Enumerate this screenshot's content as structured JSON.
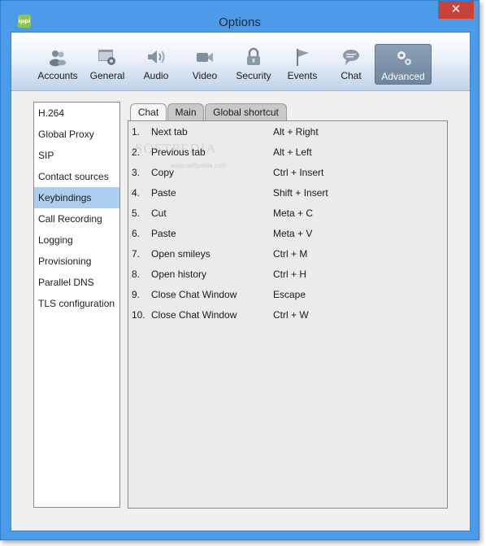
{
  "window": {
    "app_logo": "ippi",
    "title": "Options",
    "close_glyph": "✕"
  },
  "toolbar": {
    "items": [
      {
        "label": "Accounts",
        "icon": "accounts-icon"
      },
      {
        "label": "General",
        "icon": "general-icon"
      },
      {
        "label": "Audio",
        "icon": "audio-icon"
      },
      {
        "label": "Video",
        "icon": "video-icon"
      },
      {
        "label": "Security",
        "icon": "security-icon"
      },
      {
        "label": "Events",
        "icon": "events-icon"
      },
      {
        "label": "Chat",
        "icon": "chat-icon"
      },
      {
        "label": "Advanced",
        "icon": "advanced-icon",
        "active": true
      }
    ]
  },
  "sidebar": {
    "items": [
      {
        "label": "H.264"
      },
      {
        "label": "Global Proxy"
      },
      {
        "label": "SIP"
      },
      {
        "label": "Contact sources"
      },
      {
        "label": "Keybindings",
        "selected": true
      },
      {
        "label": "Call Recording"
      },
      {
        "label": "Logging"
      },
      {
        "label": "Provisioning"
      },
      {
        "label": "Parallel DNS"
      },
      {
        "label": "TLS configuration"
      }
    ]
  },
  "tabs": [
    {
      "label": "Chat",
      "active": true
    },
    {
      "label": "Main"
    },
    {
      "label": "Global shortcut"
    }
  ],
  "keybindings": [
    {
      "num": "1.",
      "action": "Next tab",
      "shortcut": "Alt + Right"
    },
    {
      "num": "2.",
      "action": "Previous tab",
      "shortcut": "Alt + Left"
    },
    {
      "num": "3.",
      "action": "Copy",
      "shortcut": "Ctrl + Insert"
    },
    {
      "num": "4.",
      "action": "Paste",
      "shortcut": "Shift + Insert"
    },
    {
      "num": "5.",
      "action": "Cut",
      "shortcut": "Meta + C"
    },
    {
      "num": "6.",
      "action": "Paste",
      "shortcut": "Meta + V"
    },
    {
      "num": "7.",
      "action": "Open smileys",
      "shortcut": "Ctrl + M"
    },
    {
      "num": "8.",
      "action": "Open history",
      "shortcut": "Ctrl + H"
    },
    {
      "num": "9.",
      "action": "Close Chat Window",
      "shortcut": "Escape"
    },
    {
      "num": "10.",
      "action": "Close Chat Window",
      "shortcut": "Ctrl + W"
    }
  ],
  "watermark": {
    "text": "SOFTPEDIA",
    "sub": "www.softpedia.com"
  }
}
